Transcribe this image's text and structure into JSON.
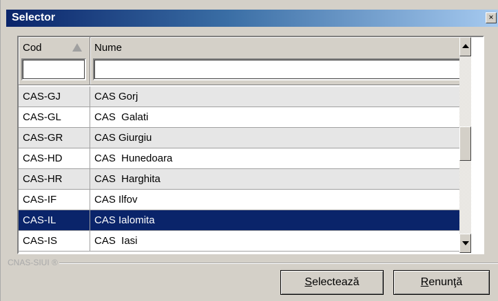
{
  "window": {
    "title": "Selector",
    "close_glyph": "×"
  },
  "grid": {
    "columns": [
      {
        "label": "Cod"
      },
      {
        "label": "Nume"
      }
    ],
    "filters": {
      "cod_value": "",
      "nume_value": ""
    },
    "rows": [
      {
        "cod": "CAS-GJ",
        "nume": "CAS Gorj"
      },
      {
        "cod": "CAS-GL",
        "nume": "CAS  Galati"
      },
      {
        "cod": "CAS-GR",
        "nume": "CAS Giurgiu"
      },
      {
        "cod": "CAS-HD",
        "nume": "CAS  Hunedoara"
      },
      {
        "cod": "CAS-HR",
        "nume": "CAS  Harghita"
      },
      {
        "cod": "CAS-IF",
        "nume": "CAS Ilfov"
      },
      {
        "cod": "CAS-IL",
        "nume": "CAS Ialomita"
      },
      {
        "cod": "CAS-IS",
        "nume": "CAS  Iasi"
      }
    ]
  },
  "footer": {
    "brand": "CNAS-SIUI ®",
    "select_button": {
      "mnemonic": "S",
      "rest": "electează"
    },
    "cancel_button": {
      "mnemonic": "R",
      "rest": "enunţă"
    }
  }
}
